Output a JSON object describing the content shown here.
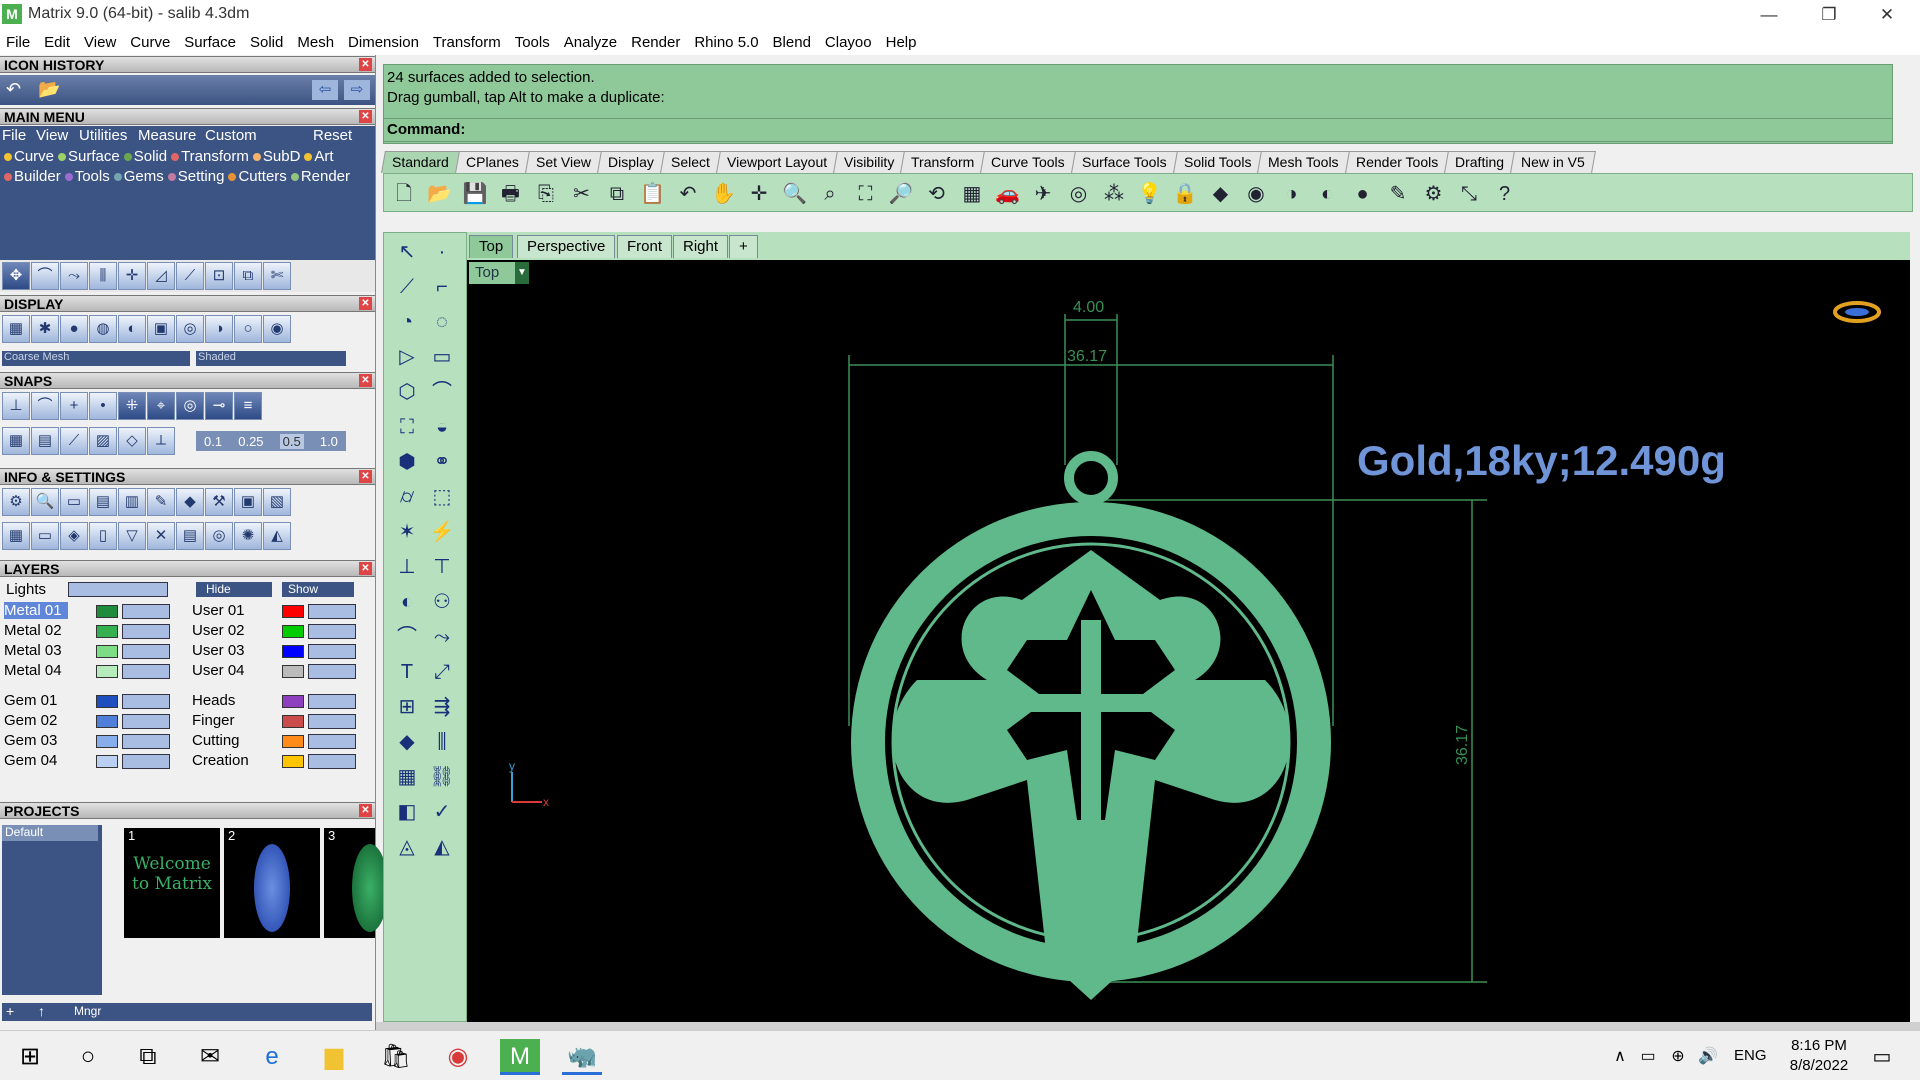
{
  "window": {
    "title": "Matrix 9.0 (64-bit) - salib 4.3dm",
    "app_icon_glyph": "M",
    "controls": {
      "minimize": "—",
      "restore": "❐",
      "close": "✕"
    }
  },
  "menu": [
    "File",
    "Edit",
    "View",
    "Curve",
    "Surface",
    "Solid",
    "Mesh",
    "Dimension",
    "Transform",
    "Tools",
    "Analyze",
    "Render",
    "Rhino 5.0",
    "Blend",
    "Clayoo",
    "Help"
  ],
  "left": {
    "icon_history": {
      "title": "ICON HISTORY"
    },
    "main_menu": {
      "title": "MAIN MENU",
      "top_items": [
        "File",
        "View",
        "Utilities",
        "Measure",
        "Custom",
        "Reset"
      ],
      "row1": [
        {
          "label": "Curve",
          "color": "#f1c232"
        },
        {
          "label": "Surface",
          "color": "#9ed167"
        },
        {
          "label": "Solid",
          "color": "#6aa84f"
        },
        {
          "label": "Transform",
          "color": "#e06666"
        },
        {
          "label": "SubD",
          "color": "#f6b26b"
        },
        {
          "label": "Art",
          "color": "#f1c232"
        }
      ],
      "row2": [
        {
          "label": "Builder",
          "color": "#e06666"
        },
        {
          "label": "Tools",
          "color": "#9b6bd1"
        },
        {
          "label": "Gems",
          "color": "#76a5af"
        },
        {
          "label": "Setting",
          "color": "#c27ba0"
        },
        {
          "label": "Cutters",
          "color": "#e69138"
        },
        {
          "label": "Render",
          "color": "#93c47d"
        }
      ]
    },
    "display": {
      "title": "DISPLAY",
      "dropdown1": "Coarse Mesh",
      "dropdown2": "Shaded"
    },
    "snaps": {
      "title": "SNAPS",
      "values": [
        "0.1",
        "0.25",
        "0.5",
        "1.0"
      ]
    },
    "info": {
      "title": "INFO & SETTINGS"
    },
    "layers": {
      "title": "LAYERS",
      "lights": "Lights",
      "hide": "Hide",
      "show": "Show",
      "col1": [
        {
          "name": "Metal 01",
          "color": "#1e8c3a",
          "selected": true
        },
        {
          "name": "Metal 02",
          "color": "#35b050"
        },
        {
          "name": "Metal 03",
          "color": "#7ddc86"
        },
        {
          "name": "Metal 04",
          "color": "#b6ecbb"
        },
        {
          "name": "Gem 01",
          "color": "#1f4fbf"
        },
        {
          "name": "Gem 02",
          "color": "#4f7fd8"
        },
        {
          "name": "Gem 03",
          "color": "#87aeea"
        },
        {
          "name": "Gem 04",
          "color": "#b9d0f2"
        }
      ],
      "col2": [
        {
          "name": "User 01",
          "color": "#ff0000"
        },
        {
          "name": "User 02",
          "color": "#00cc00"
        },
        {
          "name": "User 03",
          "color": "#0000ff"
        },
        {
          "name": "User 04",
          "color": "#bbbbbb"
        },
        {
          "name": "Heads",
          "color": "#8e3fbf"
        },
        {
          "name": "Finger",
          "color": "#c94b4b"
        },
        {
          "name": "Cutting",
          "color": "#ff8c1a"
        },
        {
          "name": "Creation",
          "color": "#ffc400"
        }
      ]
    },
    "projects": {
      "title": "PROJECTS",
      "default": "Default",
      "thumbs": [
        {
          "num": "1",
          "text": "Welcome to Matrix"
        },
        {
          "num": "2"
        },
        {
          "num": "3"
        }
      ],
      "mngr": "Mngr"
    }
  },
  "command": {
    "line1": "24 surfaces added to selection.",
    "line2": "Drag gumball, tap Alt to make a duplicate:",
    "prompt": "Command:"
  },
  "toolbar_tabs": [
    "Standard",
    "CPlanes",
    "Set View",
    "Display",
    "Select",
    "Viewport Layout",
    "Visibility",
    "Transform",
    "Curve Tools",
    "Surface Tools",
    "Solid Tools",
    "Mesh Tools",
    "Render Tools",
    "Drafting",
    "New in V5"
  ],
  "viewport_tabs": [
    "Top",
    "Perspective",
    "Front",
    "Right"
  ],
  "viewport": {
    "label": "Top",
    "dim_top": "4.00",
    "dim_width": "36.17",
    "dim_height": "36.17",
    "annotation": "Gold,18ky;12.490g",
    "axis_x": "x",
    "axis_y": "y"
  },
  "taskbar": {
    "lang": "ENG",
    "time": "8:16 PM",
    "date": "8/8/2022"
  }
}
